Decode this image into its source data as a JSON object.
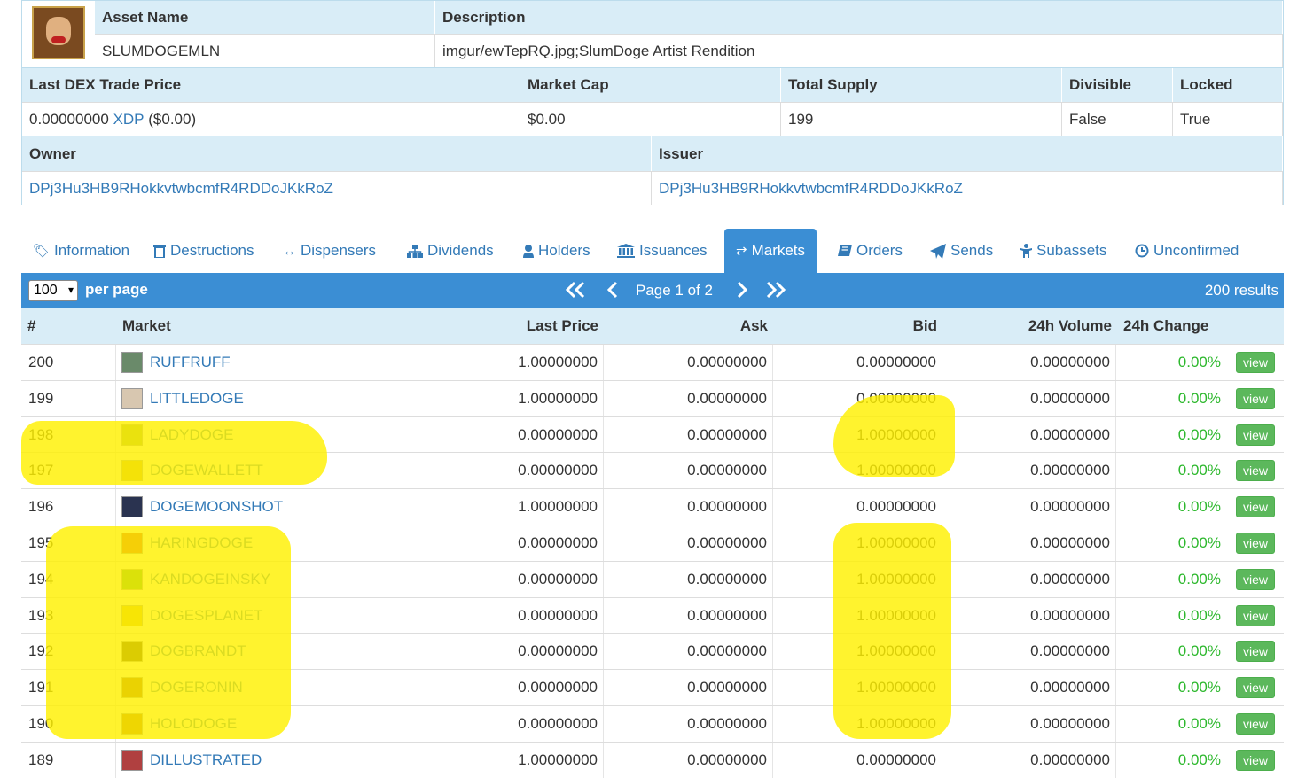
{
  "asset": {
    "name_header": "Asset Name",
    "desc_header": "Description",
    "name": "SLUMDOGEMLN",
    "description": "imgur/ewTepRQ.jpg;SlumDoge Artist Rendition",
    "last_price_header": "Last DEX Trade Price",
    "market_cap_header": "Market Cap",
    "supply_header": "Total Supply",
    "divisible_header": "Divisible",
    "locked_header": "Locked",
    "last_price_value": "0.00000000",
    "last_price_unit": "XDP",
    "last_price_usd": "($0.00)",
    "market_cap": "$0.00",
    "supply": "199",
    "divisible": "False",
    "locked": "True",
    "owner_header": "Owner",
    "issuer_header": "Issuer",
    "owner": "DPj3Hu3HB9RHokkvtwbcmfR4RDDoJKkRoZ",
    "issuer": "DPj3Hu3HB9RHokkvtwbcmfR4RDDoJKkRoZ"
  },
  "tabs": [
    {
      "label": "Information",
      "icon": "tag-icon"
    },
    {
      "label": "Destructions",
      "icon": "trash-icon"
    },
    {
      "label": "Dispensers",
      "icon": "arrows-horizontal-icon"
    },
    {
      "label": "Dividends",
      "icon": "sitemap-icon"
    },
    {
      "label": "Holders",
      "icon": "user-icon"
    },
    {
      "label": "Issuances",
      "icon": "bank-icon"
    },
    {
      "label": "Markets",
      "icon": "exchange-icon"
    },
    {
      "label": "Orders",
      "icon": "book-icon"
    },
    {
      "label": "Sends",
      "icon": "paper-plane-icon"
    },
    {
      "label": "Subassets",
      "icon": "child-icon"
    },
    {
      "label": "Unconfirmed",
      "icon": "clock-icon"
    }
  ],
  "pager": {
    "per_page_value": "100",
    "per_page_label": "per page",
    "page_label": "Page 1 of 2",
    "results": "200 results"
  },
  "table": {
    "headers": {
      "num": "#",
      "market": "Market",
      "last": "Last Price",
      "ask": "Ask",
      "bid": "Bid",
      "vol": "24h Volume",
      "chg": "24h Change"
    },
    "view_label": "view",
    "rows": [
      {
        "num": "200",
        "market": "RUFFRUFF",
        "last": "1.00000000",
        "ask": "0.00000000",
        "bid": "0.00000000",
        "vol": "0.00000000",
        "chg": "0.00%",
        "thumb": "#6a8a6a"
      },
      {
        "num": "199",
        "market": "LITTLEDOGE",
        "last": "1.00000000",
        "ask": "0.00000000",
        "bid": "0.00000000",
        "vol": "0.00000000",
        "chg": "0.00%",
        "thumb": "#d8c7b0"
      },
      {
        "num": "198",
        "market": "LADYDOGE",
        "last": "0.00000000",
        "ask": "0.00000000",
        "bid": "1.00000000",
        "vol": "0.00000000",
        "chg": "0.00%",
        "thumb": "#8aa050"
      },
      {
        "num": "197",
        "market": "DOGEWALLETT",
        "last": "0.00000000",
        "ask": "0.00000000",
        "bid": "1.00000000",
        "vol": "0.00000000",
        "chg": "0.00%",
        "thumb": "#c2a030"
      },
      {
        "num": "196",
        "market": "DOGEMOONSHOT",
        "last": "1.00000000",
        "ask": "0.00000000",
        "bid": "0.00000000",
        "vol": "0.00000000",
        "chg": "0.00%",
        "thumb": "#2a3350"
      },
      {
        "num": "195",
        "market": "HARINGDOGE",
        "last": "0.00000000",
        "ask": "0.00000000",
        "bid": "1.00000000",
        "vol": "0.00000000",
        "chg": "0.00%",
        "thumb": "#c83a2a"
      },
      {
        "num": "194",
        "market": "KANDOGEINSKY",
        "last": "0.00000000",
        "ask": "0.00000000",
        "bid": "1.00000000",
        "vol": "0.00000000",
        "chg": "0.00%",
        "thumb": "#3a9a3a"
      },
      {
        "num": "193",
        "market": "DOGESPLANET",
        "last": "0.00000000",
        "ask": "0.00000000",
        "bid": "1.00000000",
        "vol": "0.00000000",
        "chg": "0.00%",
        "thumb": "#d0b020"
      },
      {
        "num": "192",
        "market": "DOGBRANDT",
        "last": "0.00000000",
        "ask": "0.00000000",
        "bid": "1.00000000",
        "vol": "0.00000000",
        "chg": "0.00%",
        "thumb": "#3a2a10"
      },
      {
        "num": "191",
        "market": "DOGERONIN",
        "last": "0.00000000",
        "ask": "0.00000000",
        "bid": "1.00000000",
        "vol": "0.00000000",
        "chg": "0.00%",
        "thumb": "#8a4a10"
      },
      {
        "num": "190",
        "market": "HOLODOGE",
        "last": "0.00000000",
        "ask": "0.00000000",
        "bid": "1.00000000",
        "vol": "0.00000000",
        "chg": "0.00%",
        "thumb": "#a06010"
      },
      {
        "num": "189",
        "market": "DILLUSTRATED",
        "last": "1.00000000",
        "ask": "0.00000000",
        "bid": "0.00000000",
        "vol": "0.00000000",
        "chg": "0.00%",
        "thumb": "#b04040"
      }
    ]
  },
  "colors": {
    "accent": "#3b8ed4",
    "header_bg": "#d9edf7",
    "link": "#337ab7",
    "positive": "#2db82d",
    "highlight": "#fff000"
  }
}
